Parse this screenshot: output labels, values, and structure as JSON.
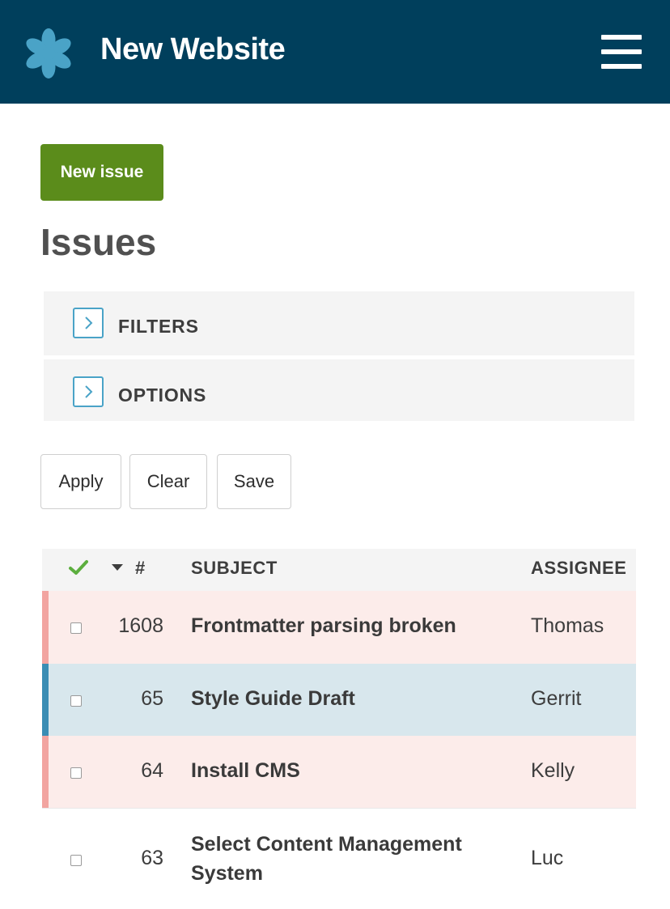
{
  "header": {
    "title": "New Website",
    "logo_icon": "asterisk-logo-icon",
    "menu_icon": "hamburger-menu-icon",
    "background_color": "#003f5c",
    "logo_color": "#4aa3c7"
  },
  "main": {
    "new_issue_label": "New issue",
    "new_issue_color": "#5b8c1b",
    "page_title": "Issues",
    "panels": [
      {
        "label": "FILTERS",
        "icon": "chevron-right-icon"
      },
      {
        "label": "OPTIONS",
        "icon": "chevron-right-icon"
      }
    ],
    "actions": {
      "apply": "Apply",
      "clear": "Clear",
      "save": "Save"
    }
  },
  "table": {
    "headers": {
      "check_icon": "checkmark-icon",
      "sort_icon": "sort-desc-icon",
      "number": "#",
      "subject": "SUBJECT",
      "assignee": "ASSIGNEE"
    },
    "rows": [
      {
        "id": "1608",
        "subject": "Frontmatter parsing broken",
        "assignee": "Thomas",
        "row_color": "#fcecea",
        "stripe_color": "#f2a4a0"
      },
      {
        "id": "65",
        "subject": "Style Guide Draft",
        "assignee": "Gerrit",
        "row_color": "#d8e7ed",
        "stripe_color": "#3a8db4"
      },
      {
        "id": "64",
        "subject": "Install CMS",
        "assignee": "Kelly",
        "row_color": "#fcecea",
        "stripe_color": "#f2a4a0"
      },
      {
        "id": "63",
        "subject": "Select Content Management System",
        "assignee": "Luc",
        "row_color": "#ffffff",
        "stripe_color": "#ffffff"
      }
    ]
  }
}
